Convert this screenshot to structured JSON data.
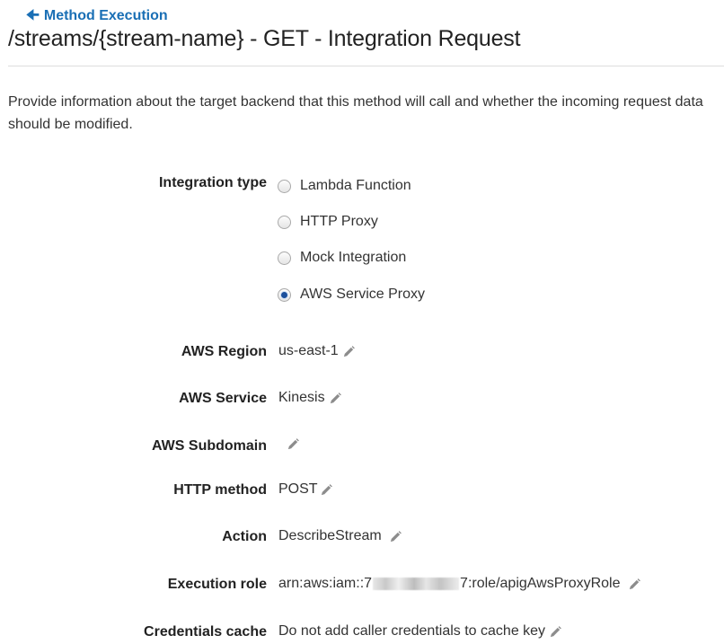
{
  "header": {
    "back_link": "Method Execution",
    "title": "/streams/{stream-name} - GET - Integration Request"
  },
  "description": "Provide information about the target backend that this method will call and whether the incoming request data should be modified.",
  "integration_type": {
    "label": "Integration type",
    "options": [
      {
        "label": "Lambda Function",
        "selected": false
      },
      {
        "label": "HTTP Proxy",
        "selected": false
      },
      {
        "label": "Mock Integration",
        "selected": false
      },
      {
        "label": "AWS Service Proxy",
        "selected": true
      }
    ]
  },
  "fields": {
    "aws_region": {
      "label": "AWS Region",
      "value": "us-east-1"
    },
    "aws_service": {
      "label": "AWS Service",
      "value": "Kinesis"
    },
    "aws_subdomain": {
      "label": "AWS Subdomain",
      "value": ""
    },
    "http_method": {
      "label": "HTTP method",
      "value": "POST"
    },
    "action": {
      "label": "Action",
      "value": "DescribeStream"
    },
    "execution_role": {
      "label": "Execution role",
      "value_prefix": "arn:aws:iam::7",
      "value_suffix": "7:role/apigAwsProxyRole"
    },
    "credentials_cache": {
      "label": "Credentials cache",
      "value": "Do not add caller credentials to cache key"
    }
  },
  "icons": {
    "back": "arrow-left-icon",
    "edit": "pencil-icon"
  },
  "colors": {
    "link": "#1a6fb5",
    "radio_selected": "#1b4f9c",
    "divider": "#dddddd"
  }
}
